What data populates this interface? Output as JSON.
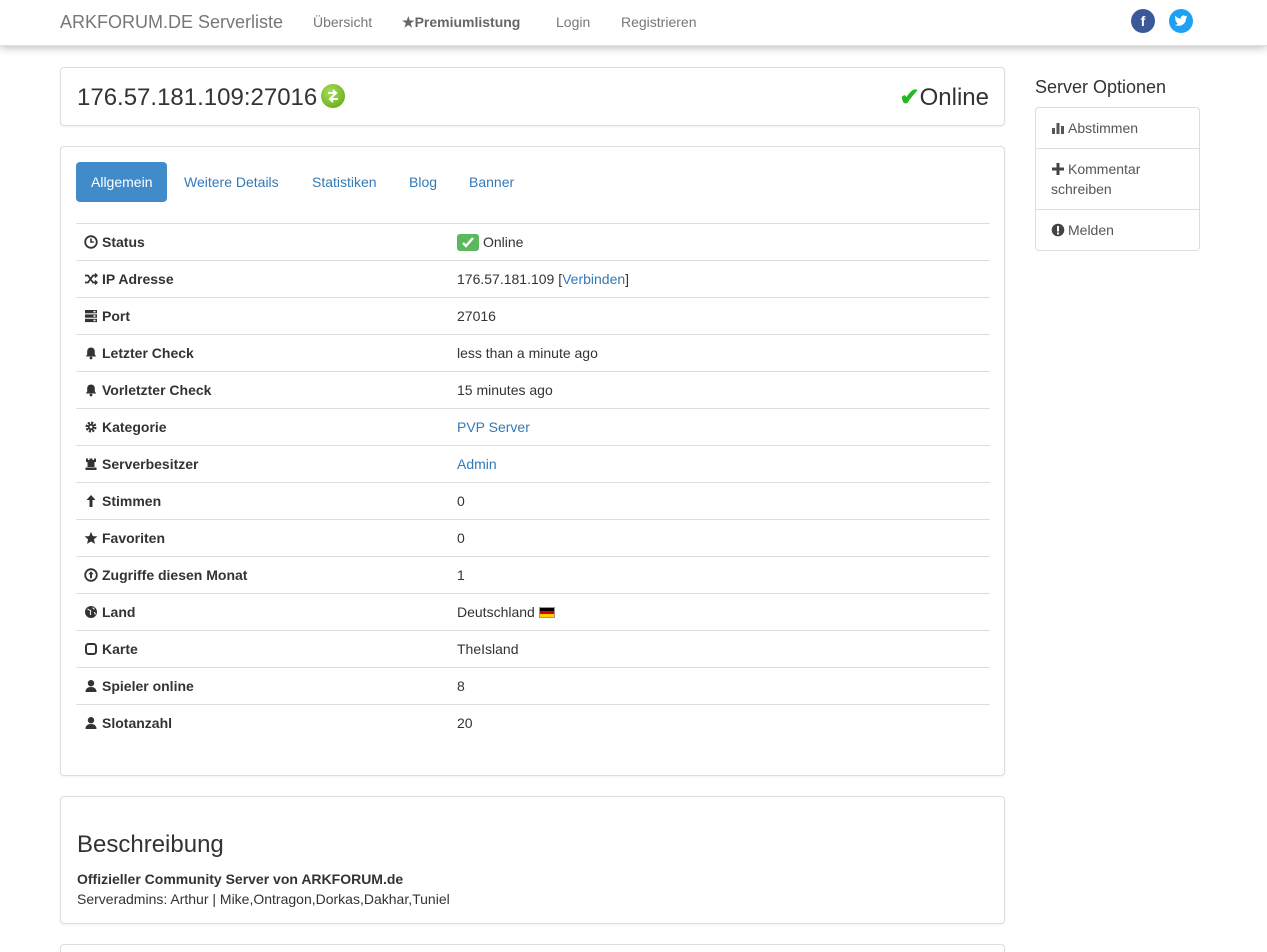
{
  "nav": {
    "brand": "ARKFORUM.DE Serverliste",
    "items": [
      {
        "label": "Übersicht"
      },
      {
        "label": "Premiumlistung"
      },
      {
        "label": "Login"
      },
      {
        "label": "Registrieren"
      }
    ],
    "social": {
      "facebook": "f",
      "twitter": "t"
    }
  },
  "server": {
    "address": "176.57.181.109:27016",
    "status": "Online"
  },
  "tabs": [
    {
      "label": "Allgemein",
      "active": true
    },
    {
      "label": "Weitere Details"
    },
    {
      "label": "Statistiken"
    },
    {
      "label": "Blog"
    },
    {
      "label": "Banner"
    }
  ],
  "info": {
    "status": {
      "label": "Status",
      "value": "Online",
      "icon": "clock-icon"
    },
    "ip": {
      "label": "IP Adresse",
      "value": "176.57.181.109",
      "link": "Verbinden",
      "icon": "shuffle-icon"
    },
    "port": {
      "label": "Port",
      "value": "27016",
      "icon": "server-icon"
    },
    "last_check": {
      "label": "Letzter Check",
      "value": "less than a minute ago",
      "icon": "bell-icon"
    },
    "prev_check": {
      "label": "Vorletzter Check",
      "value": "15 minutes ago",
      "icon": "bell-icon"
    },
    "category": {
      "label": "Kategorie",
      "value": "PVP Server",
      "icon": "gear-icon"
    },
    "owner": {
      "label": "Serverbesitzer",
      "value": "Admin",
      "icon": "tower-icon"
    },
    "votes": {
      "label": "Stimmen",
      "value": "0",
      "icon": "arrow-up-icon"
    },
    "favorites": {
      "label": "Favoriten",
      "value": "0",
      "icon": "star-icon"
    },
    "hits": {
      "label": "Zugriffe diesen Monat",
      "value": "1",
      "icon": "circle-arrow-up-icon"
    },
    "country": {
      "label": "Land",
      "value": "Deutschland",
      "icon": "globe-icon"
    },
    "map": {
      "label": "Karte",
      "value": "TheIsland",
      "icon": "unchecked-icon"
    },
    "players": {
      "label": "Spieler online",
      "value": "8",
      "icon": "user-icon"
    },
    "slots": {
      "label": "Slotanzahl",
      "value": "20",
      "icon": "user-icon"
    }
  },
  "description": {
    "title": "Beschreibung",
    "bold": "Offizieller Community Server von ARKFORUM.de",
    "text": "Serveradmins: Arthur | Mike,Ontragon,Dorkas,Dakhar,Tuniel"
  },
  "sidebar": {
    "title": "Server Optionen",
    "items": [
      {
        "label": "Abstimmen",
        "icon": "stats-icon"
      },
      {
        "label": "Kommentar schreiben",
        "icon": "plus-icon"
      },
      {
        "label": "Melden",
        "icon": "exclamation-icon"
      }
    ]
  },
  "colors": {
    "link": "#337ab7",
    "active_tab": "#428bca",
    "online_green": "#22bb22",
    "badge_green": "#5cb85c"
  }
}
